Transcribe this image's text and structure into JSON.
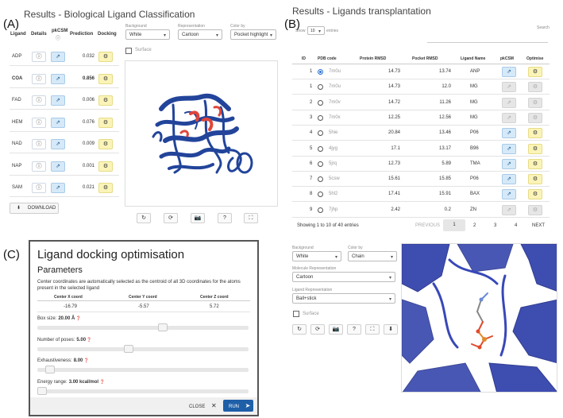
{
  "panelA": {
    "label": "(A)",
    "title": "Results - Biological Ligand Classification",
    "headers": {
      "ligand": "Ligand",
      "details": "Details",
      "pkcsm": "pkCSM",
      "prediction": "Prediction",
      "docking": "Docking"
    },
    "rows": [
      {
        "ligand": "ADP",
        "prediction": "0.032"
      },
      {
        "ligand": "COA",
        "prediction": "0.856"
      },
      {
        "ligand": "FAD",
        "prediction": "0.006"
      },
      {
        "ligand": "HEM",
        "prediction": "0.076"
      },
      {
        "ligand": "NAD",
        "prediction": "0.009"
      },
      {
        "ligand": "NAP",
        "prediction": "0.001"
      },
      {
        "ligand": "SAM",
        "prediction": "0.021"
      }
    ],
    "download_label": "DOWNLOAD",
    "background": {
      "caption": "Background",
      "value": "White"
    },
    "representation": {
      "caption": "Representation",
      "value": "Cartoon"
    },
    "color_by": {
      "caption": "Color by",
      "value": "Pocket highlight"
    },
    "surface_label": "Surface"
  },
  "panelB": {
    "label": "(B)",
    "title": "Results - Ligands transplantation",
    "show_label": "Show",
    "show_value": "10",
    "entries_label": "entries",
    "search_label": "Search",
    "headers": {
      "id": "ID",
      "pdb": "PDB code",
      "protein_rmsd": "Protein RMSD",
      "pocket_rmsd": "Pocket RMSD",
      "ligand_name": "Ligand Name",
      "pkcsm": "pkCSM",
      "optimise": "Optimise"
    },
    "rows": [
      {
        "id": "1",
        "pdb": "7m0u",
        "protein": "14.73",
        "pocket": "13.74",
        "ligand": "ANP",
        "active": true
      },
      {
        "id": "1",
        "pdb": "7m0u",
        "protein": "14.73",
        "pocket": "12.0",
        "ligand": "MG",
        "active": false
      },
      {
        "id": "2",
        "pdb": "7m0v",
        "protein": "14.72",
        "pocket": "11.26",
        "ligand": "MG",
        "active": false
      },
      {
        "id": "3",
        "pdb": "7m0x",
        "protein": "12.25",
        "pocket": "12.56",
        "ligand": "MG",
        "active": false
      },
      {
        "id": "4",
        "pdb": "5hie",
        "protein": "20.84",
        "pocket": "13.46",
        "ligand": "P06",
        "active": true
      },
      {
        "id": "5",
        "pdb": "4jyg",
        "protein": "17.1",
        "pocket": "13.17",
        "ligand": "B96",
        "active": true
      },
      {
        "id": "6",
        "pdb": "5jrq",
        "protein": "12.73",
        "pocket": "5.89",
        "ligand": "TMA",
        "active": true
      },
      {
        "id": "7",
        "pdb": "5csw",
        "protein": "15.61",
        "pocket": "15.85",
        "ligand": "P06",
        "active": true
      },
      {
        "id": "8",
        "pdb": "5hl2",
        "protein": "17.41",
        "pocket": "15.91",
        "ligand": "BAX",
        "active": true
      },
      {
        "id": "9",
        "pdb": "7jhp",
        "protein": "2.42",
        "pocket": "0.2",
        "ligand": "ZN",
        "active": false
      }
    ],
    "showing": "Showing 1 to 10 of 40 entries",
    "previous": "PREVIOUS",
    "pages": [
      "1",
      "2",
      "3",
      "4"
    ],
    "next": "NEXT",
    "background": {
      "caption": "Background",
      "value": "White"
    },
    "color_by": {
      "caption": "Color by",
      "value": "Chain"
    },
    "molecule_repr": {
      "caption": "Molecule Representation",
      "value": "Cartoon"
    },
    "ligand_repr": {
      "caption": "Ligand Representation",
      "value": "Ball+stick"
    },
    "surface_label": "Surface"
  },
  "panelC": {
    "label": "(C)",
    "title": "Ligand docking optimisation",
    "subtitle": "Parameters",
    "description": "Center coordinates are automatically selected as the centroid of all 3D coordinates for the atoms present in the selected ligand",
    "coord_headers": [
      "Center X coord",
      "Center Y coord",
      "Center Z coord"
    ],
    "coord_values": [
      "-16.79",
      "-5.57",
      "5.72"
    ],
    "params": [
      {
        "label": "Box size:",
        "value": "20.00 Å",
        "level": 0.6
      },
      {
        "label": "Number of poses:",
        "value": "5.00",
        "level": 0.43
      },
      {
        "label": "Exhaustiveness:",
        "value": "8.00",
        "level": 0.04
      },
      {
        "label": "Energy range:",
        "value": "3.00 kcal/mol",
        "level": 0.0
      }
    ],
    "close_label": "CLOSE",
    "run_label": "RUN"
  },
  "colors": {
    "accent": "#1e5fa8",
    "yellow": "#fbf4b8",
    "protein": "#22449a",
    "highlight": "#e0463a"
  }
}
